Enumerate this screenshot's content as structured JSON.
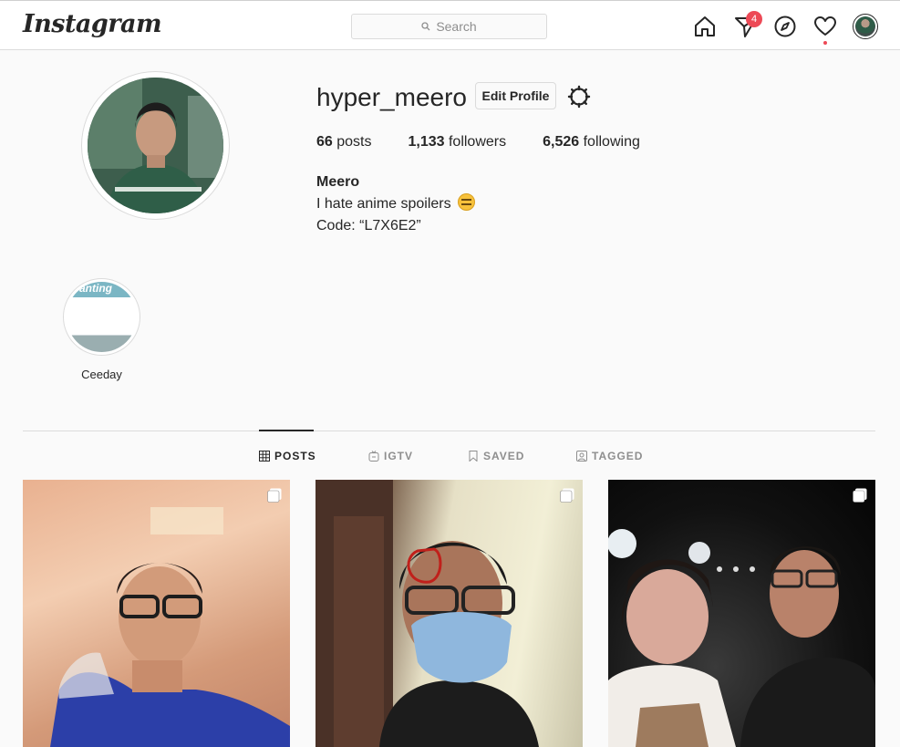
{
  "app": {
    "logo_text": "Instagram"
  },
  "search": {
    "placeholder": "Search"
  },
  "nav": {
    "direct_badge": "4",
    "icons": [
      "home-icon",
      "direct-icon",
      "explore-icon",
      "activity-icon",
      "avatar"
    ]
  },
  "profile": {
    "username": "hyper_meero",
    "edit_label": "Edit Profile",
    "posts_count": "66",
    "posts_label": " posts",
    "followers_count": "1,133",
    "followers_label": " followers",
    "following_count": "6,526",
    "following_label": " following",
    "full_name": "Meero",
    "bio_line1": "I hate anime spoilers",
    "bio_line2": "Code: “L7X6E2”"
  },
  "highlights": [
    {
      "label": "Ceeday",
      "cover_text": "anting"
    }
  ],
  "tabs": [
    {
      "label": "POSTS",
      "active": true
    },
    {
      "label": "IGTV",
      "active": false
    },
    {
      "label": "SAVED",
      "active": false
    },
    {
      "label": "TAGGED",
      "active": false
    }
  ],
  "colors": {
    "accent_red": "#ed4956",
    "border": "#dbdbdb",
    "text": "#262626",
    "muted": "#8e8e8e"
  }
}
